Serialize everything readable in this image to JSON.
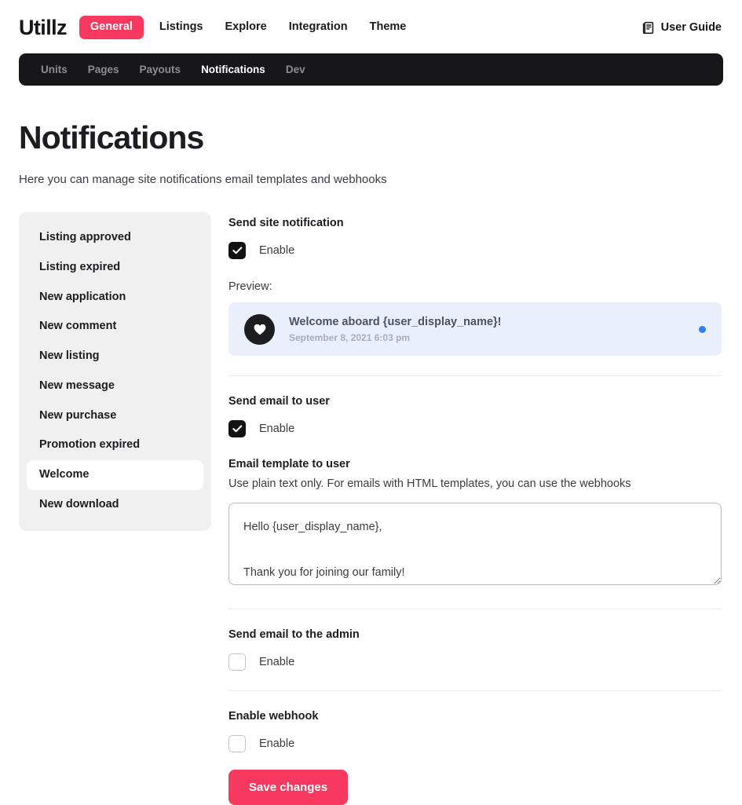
{
  "brand": {
    "logo": "Utillz"
  },
  "topnav": {
    "items": [
      {
        "label": "General",
        "active": true
      },
      {
        "label": "Listings",
        "active": false
      },
      {
        "label": "Explore",
        "active": false
      },
      {
        "label": "Integration",
        "active": false
      },
      {
        "label": "Theme",
        "active": false
      }
    ],
    "user_guide": {
      "label": "User Guide",
      "icon": "book-icon"
    }
  },
  "subnav": {
    "items": [
      {
        "label": "Units",
        "active": false
      },
      {
        "label": "Pages",
        "active": false
      },
      {
        "label": "Payouts",
        "active": false
      },
      {
        "label": "Notifications",
        "active": true
      },
      {
        "label": "Dev",
        "active": false
      }
    ]
  },
  "header": {
    "title": "Notifications",
    "description": "Here you can manage site notifications email templates and webhooks"
  },
  "sidebar": {
    "items": [
      {
        "label": "Listing approved",
        "active": false
      },
      {
        "label": "Listing expired",
        "active": false
      },
      {
        "label": "New application",
        "active": false
      },
      {
        "label": "New comment",
        "active": false
      },
      {
        "label": "New listing",
        "active": false
      },
      {
        "label": "New message",
        "active": false
      },
      {
        "label": "New purchase",
        "active": false
      },
      {
        "label": "Promotion expired",
        "active": false
      },
      {
        "label": "Welcome",
        "active": true
      },
      {
        "label": "New download",
        "active": false
      }
    ]
  },
  "main": {
    "site_notification": {
      "label": "Send site notification",
      "enable_label": "Enable",
      "enabled": true
    },
    "preview": {
      "label": "Preview:",
      "avatar_icon": "heart-icon",
      "title": "Welcome aboard {user_display_name}!",
      "timestamp": "September 8, 2021 6:03 pm",
      "unread_dot": true
    },
    "email_to_user": {
      "label": "Send email to user",
      "enable_label": "Enable",
      "enabled": true
    },
    "email_template": {
      "label": "Email template to user",
      "help": "Use plain text only. For emails with HTML templates, you can use the webhooks",
      "value": "Hello {user_display_name},\n\nThank you for joining our family!"
    },
    "email_to_admin": {
      "label": "Send email to the admin",
      "enable_label": "Enable",
      "enabled": false
    },
    "webhook": {
      "label": "Enable webhook",
      "enable_label": "Enable",
      "enabled": false
    },
    "save_label": "Save changes"
  },
  "colors": {
    "accent": "#f8395f",
    "dark": "#17171a",
    "sidebar_bg": "#f0f0f0",
    "preview_bg": "#eaf0fb",
    "unread_dot": "#2f80f0"
  }
}
